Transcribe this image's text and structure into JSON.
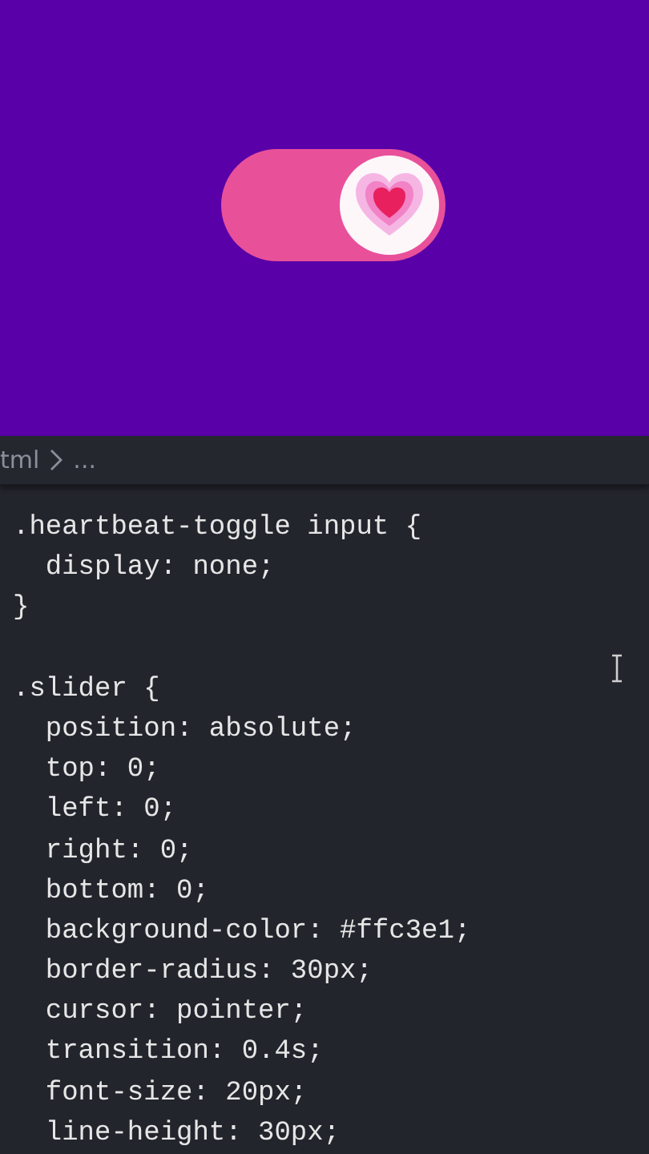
{
  "preview": {
    "toggle": {
      "on": true
    }
  },
  "breadcrumb": {
    "path": "tml",
    "more": "..."
  },
  "code_lines": [
    {
      "kind": "code",
      "text": ".heartbeat-toggle input {"
    },
    {
      "kind": "code",
      "text": "  display: none;"
    },
    {
      "kind": "code",
      "text": "}"
    },
    {
      "kind": "blank"
    },
    {
      "kind": "code",
      "text": ".slider {"
    },
    {
      "kind": "code",
      "text": "  position: absolute;"
    },
    {
      "kind": "code",
      "text": "  top: 0;"
    },
    {
      "kind": "code",
      "text": "  left: 0;"
    },
    {
      "kind": "code",
      "text": "  right: 0;"
    },
    {
      "kind": "code",
      "text": "  bottom: 0;"
    },
    {
      "kind": "code",
      "text": "  background-color: #ffc3e1;"
    },
    {
      "kind": "code",
      "text": "  border-radius: 30px;"
    },
    {
      "kind": "code",
      "text": "  cursor: pointer;"
    },
    {
      "kind": "code",
      "text": "  transition: 0.4s;"
    },
    {
      "kind": "code",
      "text": "  font-size: 20px;"
    },
    {
      "kind": "code",
      "text": "  line-height: 30px;"
    }
  ]
}
